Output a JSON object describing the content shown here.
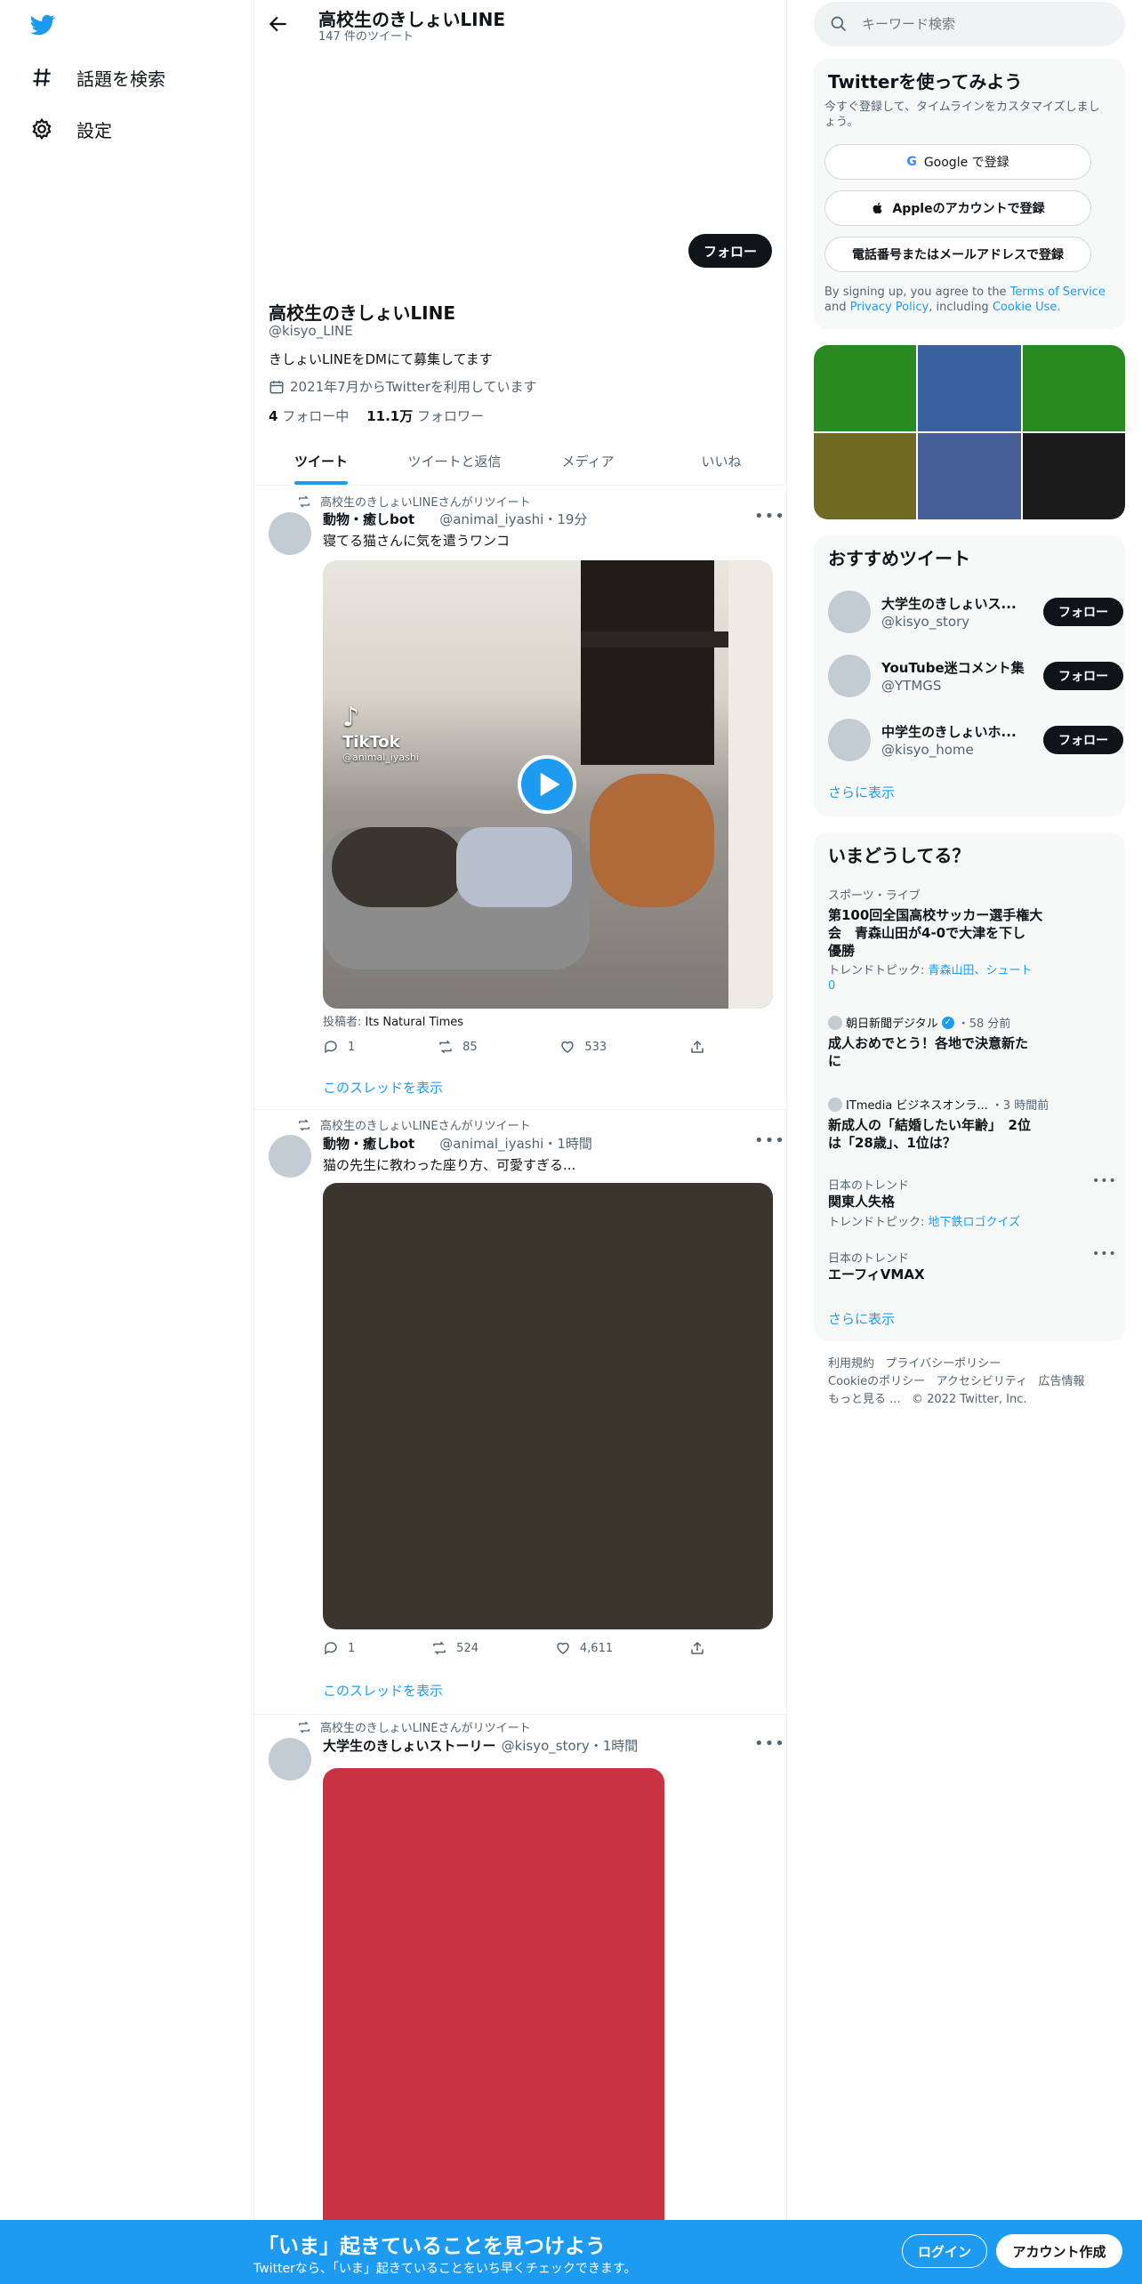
{
  "nav": {
    "explore_label": "話題を検索",
    "settings_label": "設定"
  },
  "header": {
    "title": "高校生のきしょいLINE",
    "tweet_count": "147 件のツイート"
  },
  "profile": {
    "follow_label": "フォロー",
    "name": "高校生のきしょいLINE",
    "handle": "@kisyo_LINE",
    "bio": "きしょいLINEをDMにて募集してます",
    "joined": "2021年7月からTwitterを利用しています",
    "following_count": "4",
    "following_label": "フォロー中",
    "followers_count": "11.1万",
    "followers_label": "フォロワー"
  },
  "tabs": [
    {
      "label": "ツイート"
    },
    {
      "label": "ツイートと返信"
    },
    {
      "label": "メディア"
    },
    {
      "label": "いいね"
    }
  ],
  "tweets": [
    {
      "retweet_text": "高校生のきしょいLINEさんがリツイート",
      "name": "動物・癒しbot",
      "handle": "@animal_iyashi",
      "time": "19分",
      "text": "寝てる猫さんに気を遣うワンコ",
      "media_overlay": "TikTok",
      "media_overlay_handle": "@animal_iyashi",
      "source_label": "投稿者:",
      "source_name": "Its Natural Times",
      "replies": "1",
      "retweets": "85",
      "likes": "533",
      "thread_link": "このスレッドを表示"
    },
    {
      "retweet_text": "高校生のきしょいLINEさんがリツイート",
      "name": "動物・癒しbot",
      "handle": "@animal_iyashi",
      "time": "1時間",
      "text": "猫の先生に教わった座り方、可愛すぎる...",
      "replies": "1",
      "retweets": "524",
      "likes": "4,611",
      "thread_link": "このスレッドを表示"
    },
    {
      "retweet_text": "高校生のきしょいLINEさんがリツイート",
      "name": "大学生のきしょいストーリー",
      "handle": "@kisyo_story",
      "time": "1時間"
    }
  ],
  "search": {
    "placeholder": "キーワード検索"
  },
  "signup": {
    "title": "Twitterを使ってみよう",
    "subtitle": "今すぐ登録して、タイムラインをカスタマイズしましょう。",
    "google_label": "Google で登録",
    "apple_label": "Appleのアカウントで登録",
    "phone_label": "電話番号またはメールアドレスで登録",
    "terms_prefix": "By signing up, you agree to the",
    "terms_link": "Terms of Service",
    "terms_and": "and",
    "privacy_link": "Privacy Policy",
    "terms_including": ", including",
    "cookie_link": "Cookie Use."
  },
  "media_grid_colors": [
    "#2a8a22",
    "#3a62a0",
    "#2a8a22",
    "#6e6a22",
    "#475f97",
    "#1c1c1c"
  ],
  "who_to_follow": {
    "title": "おすすめツイート",
    "accounts": [
      {
        "name": "大学生のきしょいス...",
        "handle": "@kisyo_story",
        "follow_label": "フォロー"
      },
      {
        "name": "YouTube迷コメント集",
        "handle": "@YTMGS",
        "follow_label": "フォロー"
      },
      {
        "name": "中学生のきしょいホ...",
        "handle": "@kisyo_home",
        "follow_label": "フォロー"
      }
    ],
    "show_more": "さらに表示"
  },
  "trends": {
    "title": "いまどうしてる？",
    "items": [
      {
        "meta": "スポーツ・ライブ",
        "title_l1": "第100回全国高校サッカー選手権大",
        "title_l2": "会　青森山田が4-0で大津を下し",
        "title_l3": "優勝",
        "topic_label": "トレンドトピック:",
        "topic_l1": "青森山田、シュート",
        "topic_l2": "0"
      },
      {
        "source": "朝日新聞デジタル",
        "time": "・58 分前",
        "title_l1": "成人おめでとう！各地で決意新た",
        "title_l2": "に"
      },
      {
        "source": "ITmedia ビジネスオンラ...",
        "time": "・3 時間前",
        "title_l1": "新成人の「結婚したい年齢」　2位",
        "title_l2": "は「28歳」、1位は？"
      },
      {
        "meta": "日本のトレンド",
        "title": "関東人失格",
        "topic_label": "トレンドトピック:",
        "topic": "地下鉄ロゴクイズ"
      },
      {
        "meta": "日本のトレンド",
        "title": "エーフィVMAX"
      }
    ],
    "show_more": "さらに表示"
  },
  "footer": {
    "terms": "利用規約",
    "privacy": "プライバシーポリシー",
    "cookie": "Cookieのポリシー",
    "accessibility": "アクセシビリティ",
    "ads": "広告情報",
    "more": "もっと見る ...",
    "copyright": "© 2022 Twitter, Inc."
  },
  "bottom_bar": {
    "headline": "「いま」起きていることを見つけよう",
    "sub": "Twitterなら、「いま」起きていることをいち早くチェックできます。",
    "login_label": "ログイン",
    "signup_label": "アカウント作成"
  },
  "colors": {
    "accent": "#1d9bf0",
    "text": "#0f1419",
    "muted": "#536471",
    "panel": "#f7f9f9",
    "video2_bg": "#3b362d",
    "video3_bg": "#c83241"
  }
}
